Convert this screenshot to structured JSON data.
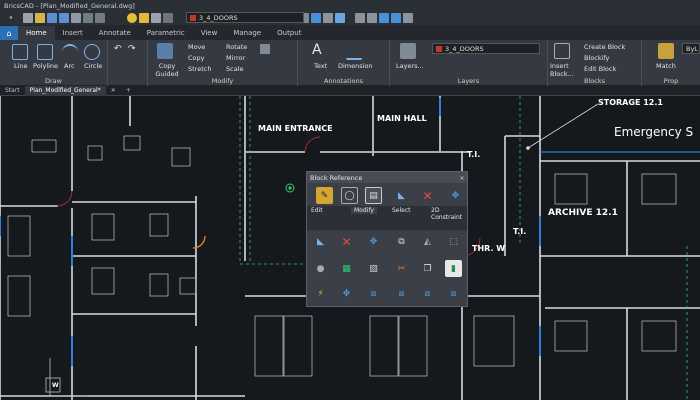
{
  "window": {
    "title": "BricsCAD - [Plan_Modified_General.dwg]"
  },
  "quick_access": {
    "layer_name": "3_4_DOORS"
  },
  "tabs": [
    {
      "label": "Home",
      "active": true
    },
    {
      "label": "Insert"
    },
    {
      "label": "Annotate"
    },
    {
      "label": "Parametric"
    },
    {
      "label": "View"
    },
    {
      "label": "Manage"
    },
    {
      "label": "Output"
    }
  ],
  "ribbon": {
    "draw": {
      "label": "Draw",
      "line": "Line",
      "polyline": "Polyline",
      "arc": "Arc",
      "circle": "Circle"
    },
    "modify": {
      "label": "Modify",
      "move": "Move",
      "rotate": "Rotate",
      "copy": "Copy",
      "mirror": "Mirror",
      "copy_guided": "Copy Guided",
      "stretch": "Stretch",
      "scale": "Scale"
    },
    "annotations": {
      "label": "Annotations",
      "text": "Text",
      "dimension": "Dimension"
    },
    "layers": {
      "label": "Layers",
      "layers_button": "Layers...",
      "layer_name": "3_4_DOORS"
    },
    "blocks": {
      "label": "Blocks",
      "insert_block": "Insert Block...",
      "create_block": "Create Block",
      "blockify": "Blockify",
      "edit_block": "Edit Block"
    },
    "properties": {
      "label": "Prop",
      "match": "Match",
      "bylayer": "ByL"
    }
  },
  "doc_tabs": {
    "start": "Start",
    "document": "Plan_Modified_General*",
    "add": "+"
  },
  "rooms": {
    "main_entrance": "MAIN ENTRANCE",
    "main_hall": "MAIN HALL",
    "storage": "STORAGE 12.1",
    "emergency": "Emergency S",
    "ti1": "T.I.",
    "ti2": "T.I.",
    "archive": "ARCHIVE 12.1",
    "thr_w": "THR. W"
  },
  "quad": {
    "title": "Block Reference",
    "tabs": [
      "Edit",
      "Modify",
      "Select",
      "2D Constraint"
    ]
  },
  "ucs": {
    "w": "W"
  }
}
